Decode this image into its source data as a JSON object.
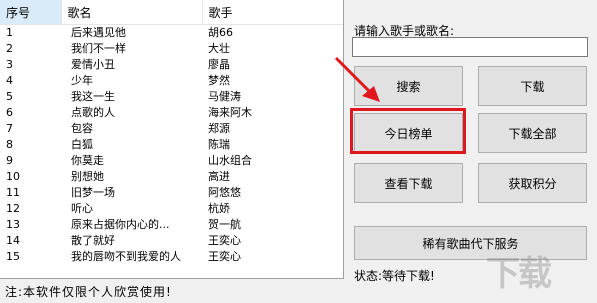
{
  "table": {
    "headers": [
      "序号",
      "歌名",
      "歌手"
    ],
    "rows": [
      {
        "no": "1",
        "song": "后来遇见他",
        "singer": "胡66"
      },
      {
        "no": "2",
        "song": "我们不一样",
        "singer": "大壮"
      },
      {
        "no": "3",
        "song": "爱情小丑",
        "singer": "廖晶"
      },
      {
        "no": "4",
        "song": "少年",
        "singer": "梦然"
      },
      {
        "no": "5",
        "song": "我这一生",
        "singer": "马健涛"
      },
      {
        "no": "6",
        "song": "点歌的人",
        "singer": "海来阿木"
      },
      {
        "no": "7",
        "song": "包容",
        "singer": "郑源"
      },
      {
        "no": "8",
        "song": "白狐",
        "singer": "陈瑞"
      },
      {
        "no": "9",
        "song": "你莫走",
        "singer": "山水组合"
      },
      {
        "no": "10",
        "song": "别想她",
        "singer": "高进"
      },
      {
        "no": "11",
        "song": "旧梦一场",
        "singer": "阿悠悠"
      },
      {
        "no": "12",
        "song": "听心",
        "singer": "杭娇"
      },
      {
        "no": "13",
        "song": "原来占据你内心的...",
        "singer": "贺一航"
      },
      {
        "no": "14",
        "song": "散了就好",
        "singer": "王奕心"
      },
      {
        "no": "15",
        "song": "我的唇吻不到我爱的人",
        "singer": "王奕心"
      }
    ]
  },
  "footer_note": "注:本软件仅限个人欣赏使用!",
  "search": {
    "prompt": "请输入歌手或歌名:",
    "value": ""
  },
  "buttons": {
    "search": "搜索",
    "download": "下载",
    "today_chart": "今日榜单",
    "download_all": "下载全部",
    "view_download": "查看下载",
    "get_points": "获取积分",
    "rare_songs": "稀有歌曲代下服务"
  },
  "status": "状态:等待下载!",
  "colors": {
    "highlight": "#e0181e",
    "arrow": "#e0181e",
    "header_selected": "#d9ebf9"
  }
}
